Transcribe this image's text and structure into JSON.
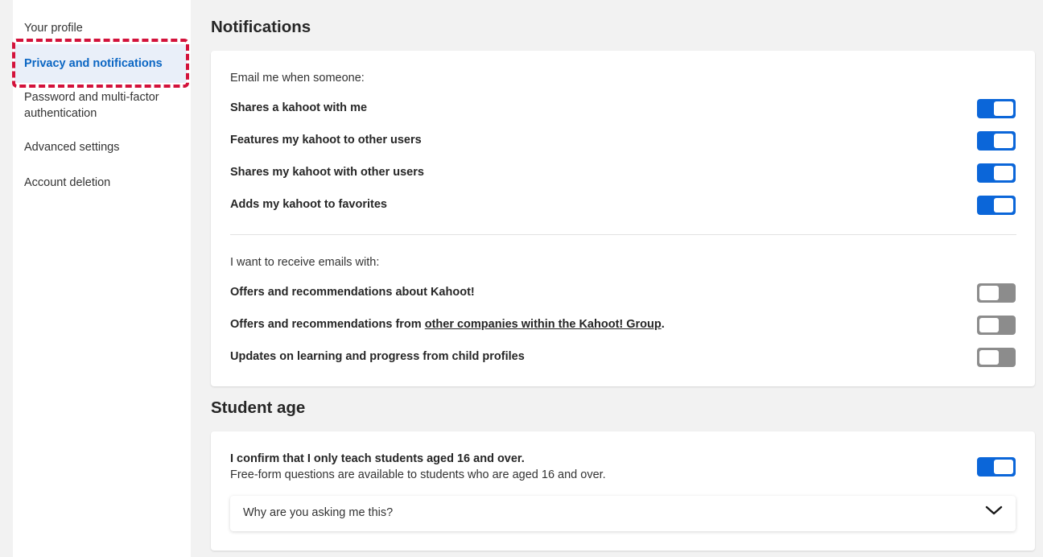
{
  "sidebar": {
    "items": [
      {
        "label": "Your profile"
      },
      {
        "label": "Privacy and notifications",
        "active": true
      },
      {
        "label": "Password and multi-factor authentication"
      },
      {
        "label": "Advanced settings"
      },
      {
        "label": "Account deletion"
      }
    ]
  },
  "notifications": {
    "title": "Notifications",
    "email_group_label": "Email me when someone:",
    "email_rows": [
      {
        "label": "Shares a kahoot with me",
        "enabled": true
      },
      {
        "label": "Features my kahoot to other users",
        "enabled": true
      },
      {
        "label": "Shares my kahoot with other users",
        "enabled": true
      },
      {
        "label": "Adds my kahoot to favorites",
        "enabled": true
      }
    ],
    "receive_group_label": "I want to receive emails with:",
    "receive_rows": [
      {
        "label": "Offers and recommendations about Kahoot!",
        "enabled": false
      },
      {
        "label_prefix": "Offers and recommendations from ",
        "link": "other companies within the Kahoot! Group",
        "label_suffix": ".",
        "enabled": false
      },
      {
        "label": "Updates on learning and progress from child profiles",
        "enabled": false
      }
    ]
  },
  "student_age": {
    "title": "Student age",
    "confirm_label": "I confirm that I only teach students aged 16 and over.",
    "confirm_sub": "Free-form questions are available to students who are aged 16 and over.",
    "enabled": true,
    "accordion_label": "Why are you asking me this?"
  },
  "colors": {
    "accent": "#0b66d9",
    "highlight": "#d3123b"
  }
}
